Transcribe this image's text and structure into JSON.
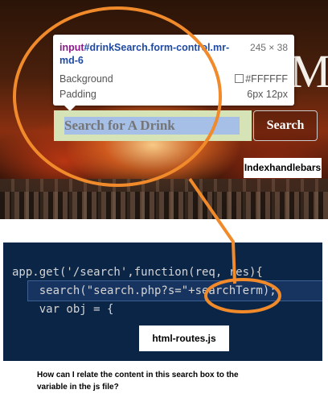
{
  "page": {
    "hero_title_fragment": "M"
  },
  "tooltip": {
    "selector_tag": "input",
    "selector_rest": "#drinkSearch.form-control.mr-md-6",
    "size": "245 × 38",
    "background_label": "Background",
    "background_value": "#FFFFFF",
    "padding_label": "Padding",
    "padding_value": "6px 12px"
  },
  "search": {
    "placeholder": "Search for A Drink",
    "button_label": "Search"
  },
  "labels": {
    "indexhandlebars": "Indexhandlebars",
    "html_routes": "html-routes.js"
  },
  "code": {
    "line1": "app.get('/search',function(req, res){",
    "line2": "    search(\"search.php?s=\"+searchTerm);",
    "line3": "    var obj = {"
  },
  "question": "How can I relate the content in this search box to the variable in the js file?",
  "colors": {
    "annotation": "#f08a2a",
    "code_bg": "#0b2547"
  }
}
